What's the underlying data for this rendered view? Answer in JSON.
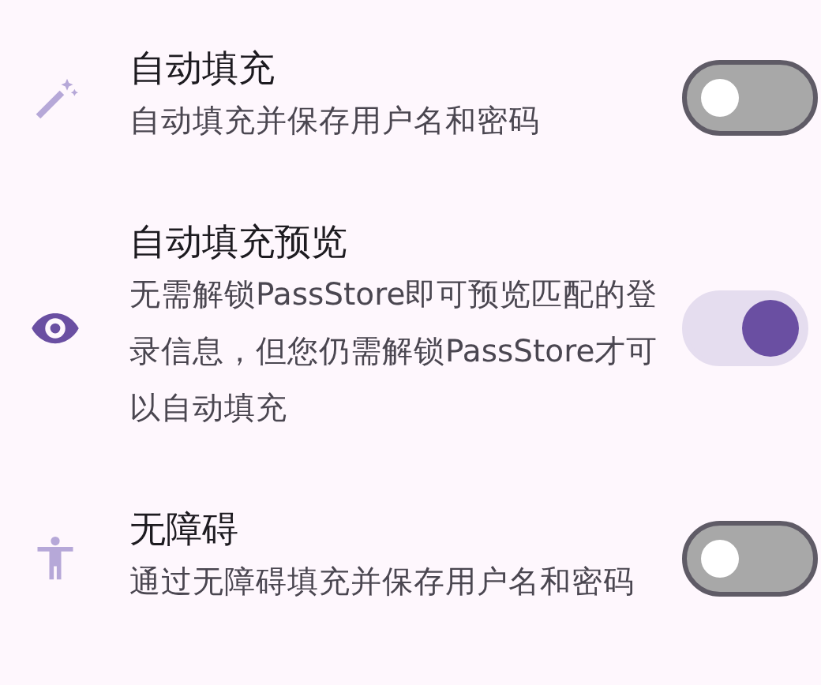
{
  "settings": [
    {
      "title": "自动填充",
      "subtitle": "自动填充并保存用户名和密码",
      "on": false
    },
    {
      "title": "自动填充预览",
      "subtitle": "无需解锁PassStore即可预览匹配的登录信息，但您仍需解锁PassStore才可以自动填充",
      "on": true
    },
    {
      "title": "无障碍",
      "subtitle": "通过无障碍填充并保存用户名和密码",
      "on": false
    }
  ]
}
